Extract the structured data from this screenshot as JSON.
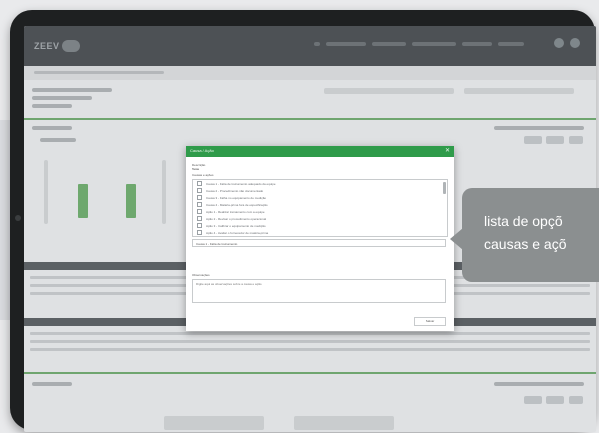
{
  "app": {
    "logo_text": "ZEEV",
    "breadcrumb": ""
  },
  "modal": {
    "title": "Causa / Ação",
    "close_glyph": "✕",
    "field1_label": "Descrição",
    "field1_value": "Teste",
    "field2_label": "Causas e ações",
    "list_options": [
      "Causa 1 - Falta de treinamento adequado da equipe",
      "Causa 2 - Procedimento não documentado",
      "Causa 3 - Falha no equipamento de medição",
      "Causa 4 - Matéria-prima fora de especificação",
      "Ação 1 - Realizar treinamento com a equipe",
      "Ação 2 - Revisar o procedimento operacional",
      "Ação 3 - Calibrar o equipamento de medição",
      "Ação 4 - Avaliar o fornecedor de matéria-prima"
    ],
    "selected_value": "Causa 1 - Falta de treinamento",
    "field3_label": "Observações",
    "textarea_value": "Digite aqui as observações sobre a causa e ação",
    "footer_button": "Salvar"
  },
  "callout": {
    "line1": "lista de opçõ",
    "line2": "causas e açõ"
  },
  "colors": {
    "accent": "#2f9b4a",
    "header": "#4d5155",
    "callout": "#8b8f90"
  }
}
